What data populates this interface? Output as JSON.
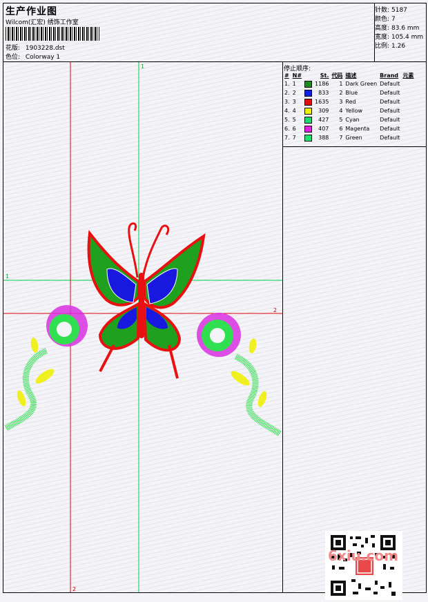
{
  "header": {
    "title": "生产作业图",
    "subtitle": "Wilcom(汇宏) 绣饰工作室",
    "design_label": "花版:",
    "design_value": "1903228.dst",
    "colorway_label": "色位:",
    "colorway_value": "Colorway 1"
  },
  "stats": [
    {
      "label": "针数:",
      "value": "5187"
    },
    {
      "label": "颜色:",
      "value": "7"
    },
    {
      "label": "高度:",
      "value": "83.6 mm"
    },
    {
      "label": "宽度:",
      "value": "105.4 mm"
    },
    {
      "label": "比例:",
      "value": "1.26"
    }
  ],
  "sequence": {
    "title": "停止顺序:",
    "columns": [
      "#",
      "N#",
      "St.",
      "代码",
      "描述",
      "Brand",
      "元素"
    ],
    "rows": [
      {
        "num": "1.",
        "n": "1",
        "color": "#1f8a1f",
        "st": "1186",
        "code": "1",
        "desc": "Dark Green",
        "brand": "Default"
      },
      {
        "num": "2.",
        "n": "2",
        "color": "#1020e0",
        "st": "833",
        "code": "2",
        "desc": "Blue",
        "brand": "Default"
      },
      {
        "num": "3.",
        "n": "3",
        "color": "#e01010",
        "st": "1635",
        "code": "3",
        "desc": "Red",
        "brand": "Default"
      },
      {
        "num": "4.",
        "n": "4",
        "color": "#f0f010",
        "st": "309",
        "code": "4",
        "desc": "Yellow",
        "brand": "Default"
      },
      {
        "num": "5.",
        "n": "5",
        "color": "#20d870",
        "st": "427",
        "code": "5",
        "desc": "Cyan",
        "brand": "Default"
      },
      {
        "num": "6.",
        "n": "6",
        "color": "#e020e0",
        "st": "407",
        "code": "6",
        "desc": "Magenta",
        "brand": "Default"
      },
      {
        "num": "7.",
        "n": "7",
        "color": "#20e070",
        "st": "388",
        "code": "7",
        "desc": "Green",
        "brand": "Default"
      }
    ]
  },
  "guides": {
    "v_green": "1",
    "h_green": "1",
    "h_red": "2",
    "v_red": "2"
  },
  "watermark": "6xiu.com",
  "colors": {
    "guide_red": "#e00000",
    "guide_green": "#00d040",
    "wing_red": "#e81010",
    "wing_green": "#1fa01f",
    "wing_blue": "#1818e0",
    "flower_magenta": "#d830e0",
    "flower_green": "#30e050",
    "leaf_yellow": "#f0f020"
  }
}
